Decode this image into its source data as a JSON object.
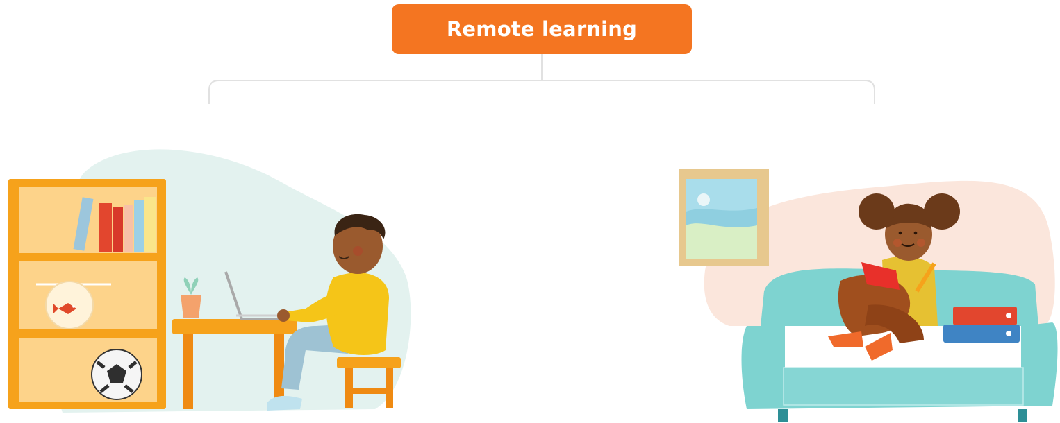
{
  "header": {
    "title": "Remote learning"
  },
  "colors": {
    "accent": "#F47521",
    "connector": "#E1E1E1",
    "blob_left": "#E3F2EF",
    "blob_right": "#FBE6DC",
    "shelf": "#F6A21B",
    "shelf_dark": "#EF8A12",
    "couch": "#7ED3D0",
    "couch_dark": "#5CBFBE",
    "hoodie": "#F5C518",
    "skin": "#9A5A2E",
    "hair": "#3A2414",
    "pants_boy": "#9EC2D3",
    "pants_girl": "#A04F1E",
    "frame": "#E7C88E"
  },
  "scenes": {
    "left": {
      "icon": "boy-at-laptop-illustration"
    },
    "right": {
      "icon": "girl-reading-on-couch-illustration"
    }
  }
}
